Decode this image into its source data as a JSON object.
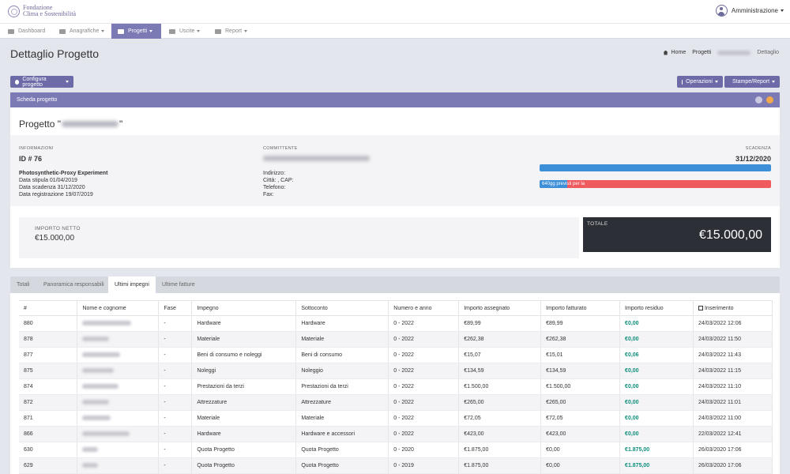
{
  "brand": {
    "line1": "Fondazione",
    "line2": "Clima e Sostenibilità"
  },
  "user": {
    "name": "Amministrazione"
  },
  "nav": {
    "dashboard": "Dashboard",
    "anagrafiche": "Anagrafiche",
    "progetti": "Progetti",
    "uscite": "Uscite",
    "report": "Report"
  },
  "page": {
    "title": "Dettaglio Progetto"
  },
  "breadcrumb": {
    "home": "Home",
    "progetti": "Progetti",
    "current": "Dettaglio"
  },
  "toolbar": {
    "configura": "Configura progetto",
    "operazioni": "Operazioni",
    "stampe": "Stampe/Report"
  },
  "card": {
    "header": "Scheda progetto",
    "project_prefix": "Progetto \"",
    "project_suffix": "\"",
    "info": {
      "label": "INFORMAZIONI",
      "id": "ID # 76",
      "name": "Photosynthetic-Proxy Experiment",
      "stipula": "Data stipula 01/04/2019",
      "scadenza": "Data scadenza 31/12/2020",
      "registrazione": "Data registrazione 19/07/2019"
    },
    "committente": {
      "label": "COMMITTENTE",
      "indirizzo": "Indirizzo:",
      "citta": "Città: , CAP:",
      "telefono": "Telefono:",
      "fax": "Fax:"
    },
    "scadenza": {
      "label": "SCADENZA",
      "date": "31/12/2020",
      "progress_label": "640gg previsti per la",
      "progress_fraction": 0.12
    },
    "importo": {
      "label": "IMPORTO NETTO",
      "value": "€15.000,00"
    },
    "totale": {
      "label": "TOTALE",
      "value": "€15.000,00"
    }
  },
  "tabs": [
    "Totali",
    "Panoramica responsabili",
    "Ultimi impegni",
    "Ultime fatture"
  ],
  "table": {
    "headers": [
      "#",
      "Nome e cognome",
      "Fase",
      "Impegno",
      "Sottoconto",
      "Numero e anno",
      "Importo assegnato",
      "Importo fatturato",
      "Importo residuo",
      "Inserimento"
    ],
    "rows": [
      [
        "880",
        "-",
        "Hardware",
        "Hardware",
        "0 - 2022",
        "€89,99",
        "€89,99",
        "€0,00",
        "24/03/2022 12:06"
      ],
      [
        "878",
        "-",
        "Materiale",
        "Materiale",
        "0 - 2022",
        "€262,38",
        "€262,38",
        "€0,00",
        "24/03/2022 11:50"
      ],
      [
        "877",
        "-",
        "Beni di consumo e noleggi",
        "Beni di consumo",
        "0 - 2022",
        "€15,07",
        "€15,01",
        "€0,06",
        "24/03/2022 11:43"
      ],
      [
        "875",
        "-",
        "Noleggi",
        "Noleggio",
        "0 - 2022",
        "€134,59",
        "€134,59",
        "€0,00",
        "24/03/2022 11:15"
      ],
      [
        "874",
        "-",
        "Prestazioni da terzi",
        "Prestazioni da terzi",
        "0 - 2022",
        "€1.500,00",
        "€1.500,00",
        "€0,00",
        "24/03/2022 11:10"
      ],
      [
        "872",
        "-",
        "Attrezzature",
        "Attrezzature",
        "0 - 2022",
        "€265,00",
        "€265,00",
        "€0,00",
        "24/03/2022 11:01"
      ],
      [
        "871",
        "-",
        "Materiale",
        "Materiale",
        "0 - 2022",
        "€72,05",
        "€72,05",
        "€0,00",
        "24/03/2022 11:00"
      ],
      [
        "866",
        "-",
        "Hardware",
        "Hardware e accessori",
        "0 - 2022",
        "€423,00",
        "€423,00",
        "€0,00",
        "22/03/2022 12:41"
      ],
      [
        "630",
        "-",
        "Quota Progetto",
        "Quota Progetto",
        "0 - 2020",
        "€1.875,00",
        "€0,00",
        "€1.875,00",
        "26/03/2020 17:06"
      ],
      [
        "629",
        "-",
        "Quota Progetto",
        "Quota Progetto",
        "0 - 2019",
        "€1.875,00",
        "€0,00",
        "€1.875,00",
        "26/03/2020 17:06"
      ]
    ]
  },
  "colors": {
    "accent": "#7c7ab5",
    "button": "#6c6ba8",
    "green_value": "#0e8f7e",
    "progress_blue": "#3d8fd8",
    "progress_red": "#ef5a5f",
    "dark_panel": "#2c2f36"
  }
}
